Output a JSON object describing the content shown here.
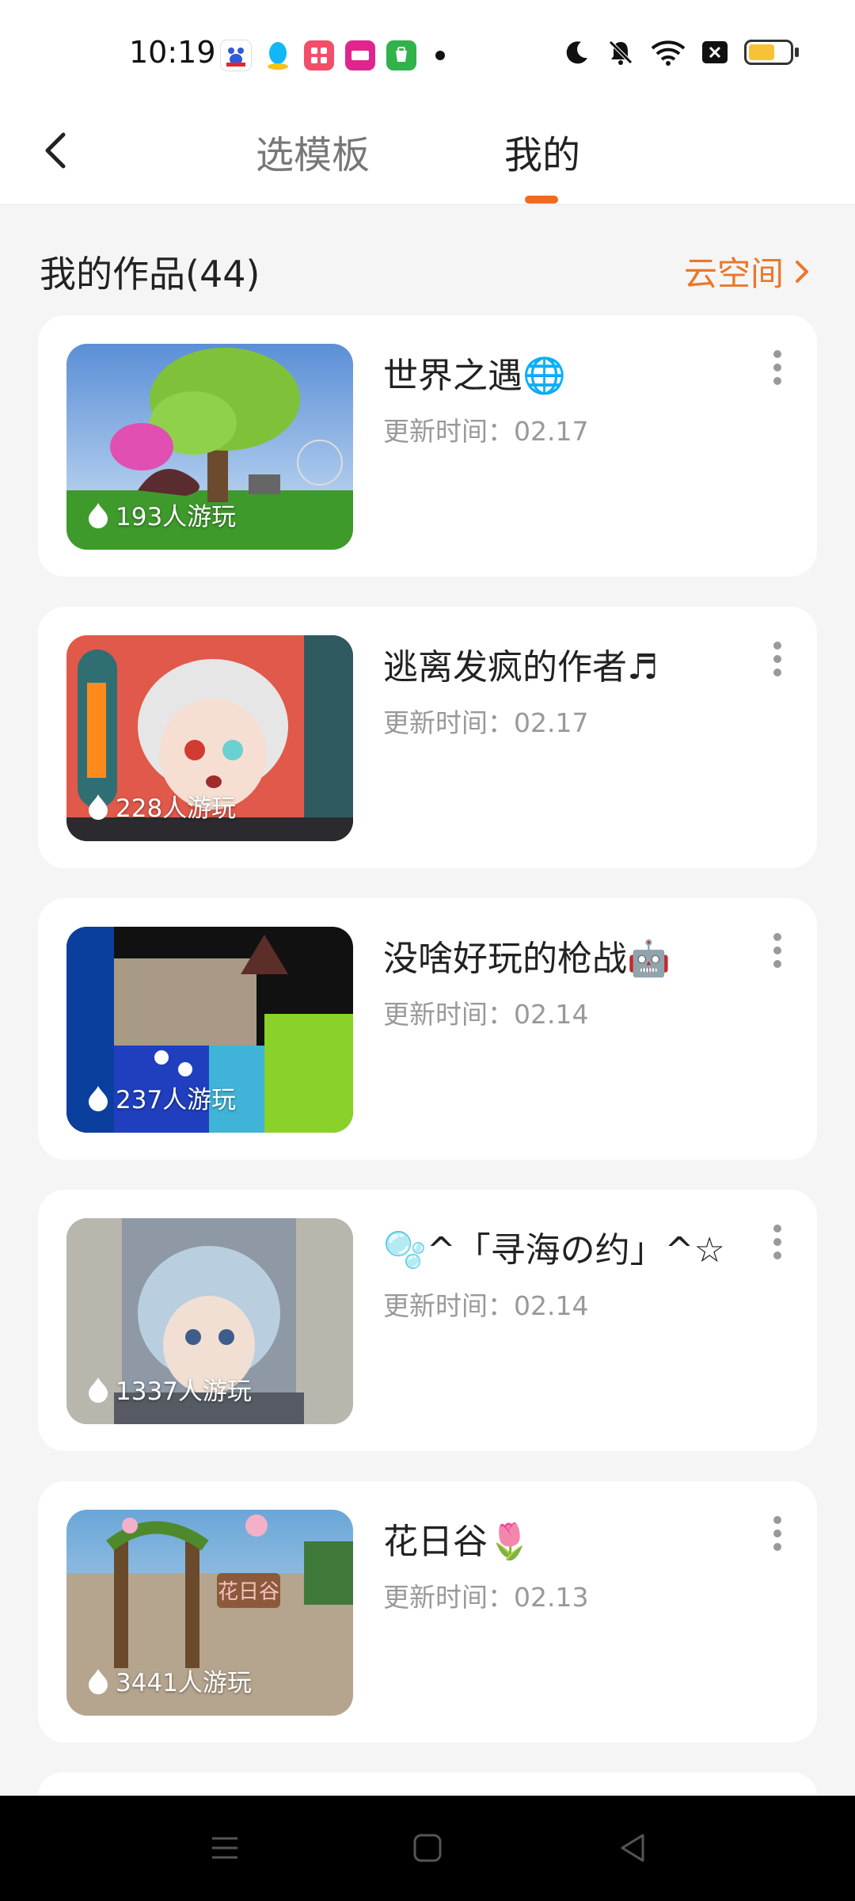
{
  "status": {
    "time": "10:19",
    "apps": [
      "baidu-icon",
      "qq-icon",
      "app-icon",
      "store-icon",
      "wechat-icon"
    ],
    "indicators": [
      "moon-icon",
      "mute-icon",
      "wifi-icon",
      "x-icon",
      "battery-icon"
    ]
  },
  "header": {
    "tabs": [
      {
        "label": "选模板",
        "active": false
      },
      {
        "label": "我的",
        "active": true
      }
    ]
  },
  "section": {
    "title": "我的作品(44)",
    "cloud_label": "云空间"
  },
  "works": [
    {
      "title": "世界之遇🌐",
      "date": "更新时间：02.17",
      "plays": "193人游玩"
    },
    {
      "title": "逃离发疯的作者♬",
      "date": "更新时间：02.17",
      "plays": "228人游玩"
    },
    {
      "title": "没啥好玩的枪战🤖",
      "date": "更新时间：02.14",
      "plays": "237人游玩"
    },
    {
      "title": "🫧^「寻海の约」^☆",
      "date": "更新时间：02.14",
      "plays": "1337人游玩"
    },
    {
      "title": "花日谷🌷",
      "date": "更新时间：02.13",
      "plays": "3441人游玩"
    }
  ],
  "thumbnail_text": {
    "work5_sign": "花日谷"
  },
  "colors": {
    "accent": "#f06a21",
    "cloud": "#e9782b"
  }
}
